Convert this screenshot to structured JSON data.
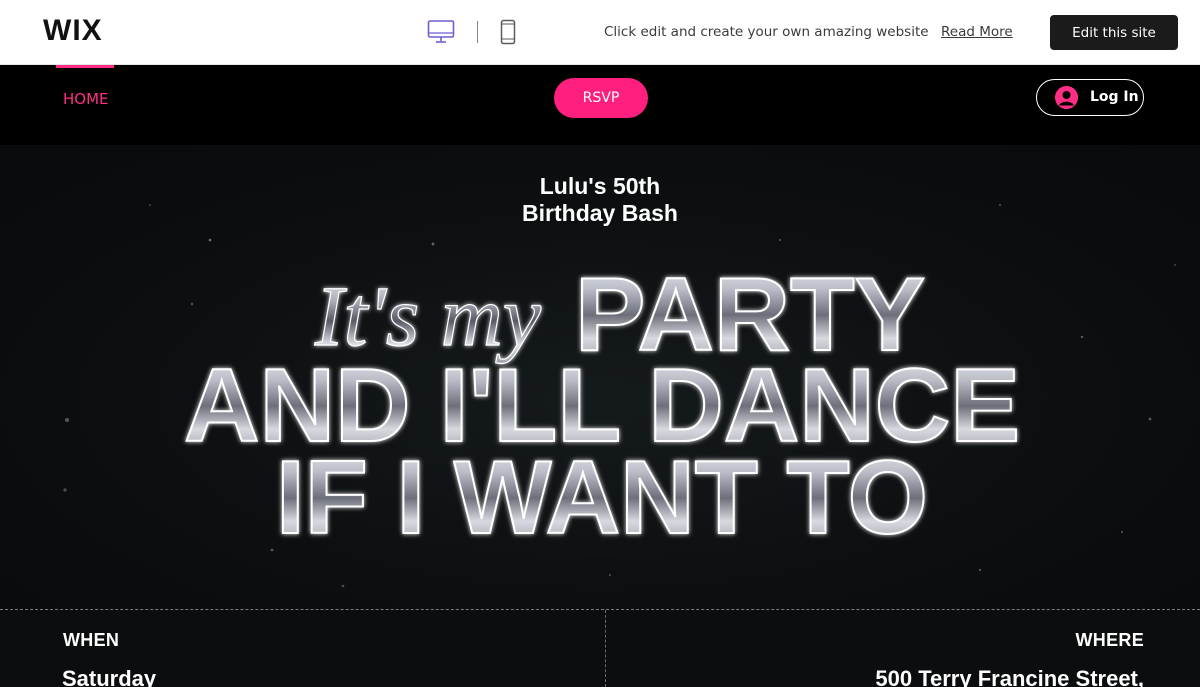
{
  "wix_bar": {
    "logo": "WIX",
    "desktop_icon": "desktop-monitor-icon",
    "mobile_icon": "mobile-phone-icon",
    "promo_text": "Click edit and create your own amazing website",
    "read_more": "Read More",
    "edit_button": "Edit this site"
  },
  "nav": {
    "home": "HOME",
    "rsvp": "RSVP",
    "login": "Log In",
    "login_icon": "user-avatar-icon"
  },
  "hero": {
    "subtitle_line1": "Lulu's 50th",
    "subtitle_line2": "Birthday Bash",
    "script_text": "It's my",
    "line1": "PARTY",
    "line2": "AND I'LL DANCE",
    "line3": "IF I WANT TO"
  },
  "details": {
    "when_label": "WHEN",
    "when_value": "Saturday",
    "where_label": "WHERE",
    "where_value": "500 Terry Francine Street,"
  },
  "colors": {
    "accent_pink": "#ff1f7f",
    "nav_active": "#ff2e84",
    "background": "#000000",
    "wix_bar": "#ffffff",
    "device_icon_purple": "#6b5fd1"
  }
}
